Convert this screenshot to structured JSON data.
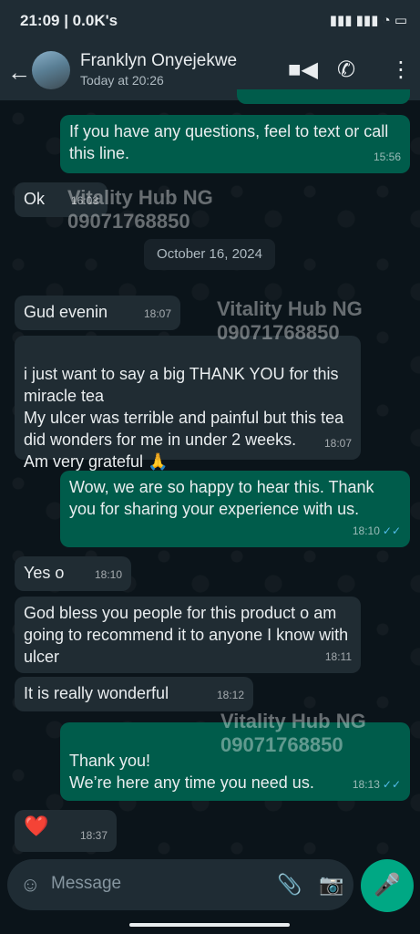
{
  "status_bar": {
    "time": "21:09 | 0.0K's",
    "icons": "▮▮▮ ▮▮▮ ◔ ▭"
  },
  "header": {
    "back_icon": "←",
    "name": "Franklyn Onyejekwe",
    "last_seen": "Today at 20:26",
    "video_icon": "■◀",
    "call_icon": "✆",
    "menu_icon": "⋮"
  },
  "messages": [
    {
      "dir": "out",
      "text": "If you have any questions, feel to text or call this line.",
      "time": "15:56"
    },
    {
      "dir": "in",
      "text": "Ok",
      "time": "16:03"
    },
    {
      "dir": "in",
      "text": "Gud evenin",
      "time": "18:07"
    },
    {
      "dir": "in",
      "text": "i just want to say a big THANK YOU for this miracle tea\nMy ulcer was terrible and painful but this tea did wonders for me in under 2 weeks.\nAm very grateful 🙏",
      "time": "18:07"
    },
    {
      "dir": "out",
      "text": "Wow, we are so happy to hear this. Thank you for sharing your experience with us.",
      "time": "18:10",
      "ticks": "✓✓"
    },
    {
      "dir": "in",
      "text": "Yes o",
      "time": "18:10"
    },
    {
      "dir": "in",
      "text": "God bless you people for this product o am going to recommend it to anyone I know with ulcer",
      "time": "18:11"
    },
    {
      "dir": "in",
      "text": "It is really wonderful",
      "time": "18:12"
    },
    {
      "dir": "out",
      "text": "Thank you!\nWe’re here any time you need us.",
      "time": "18:13",
      "ticks": "✓✓"
    },
    {
      "dir": "in",
      "text": "❤️",
      "time": "18:37"
    }
  ],
  "date_chip": "October 16, 2024",
  "watermark": {
    "brand": "Vitality Hub NG",
    "phone": "09071768850"
  },
  "composer": {
    "emoji_icon": "☺",
    "placeholder": "Message",
    "attach_icon": "📎",
    "camera_icon": "📷",
    "mic_icon": "🎤"
  },
  "colors": {
    "incoming": "#202c33",
    "outgoing": "#005c4b",
    "accent": "#00a884",
    "ticks": "#53bdeb"
  }
}
